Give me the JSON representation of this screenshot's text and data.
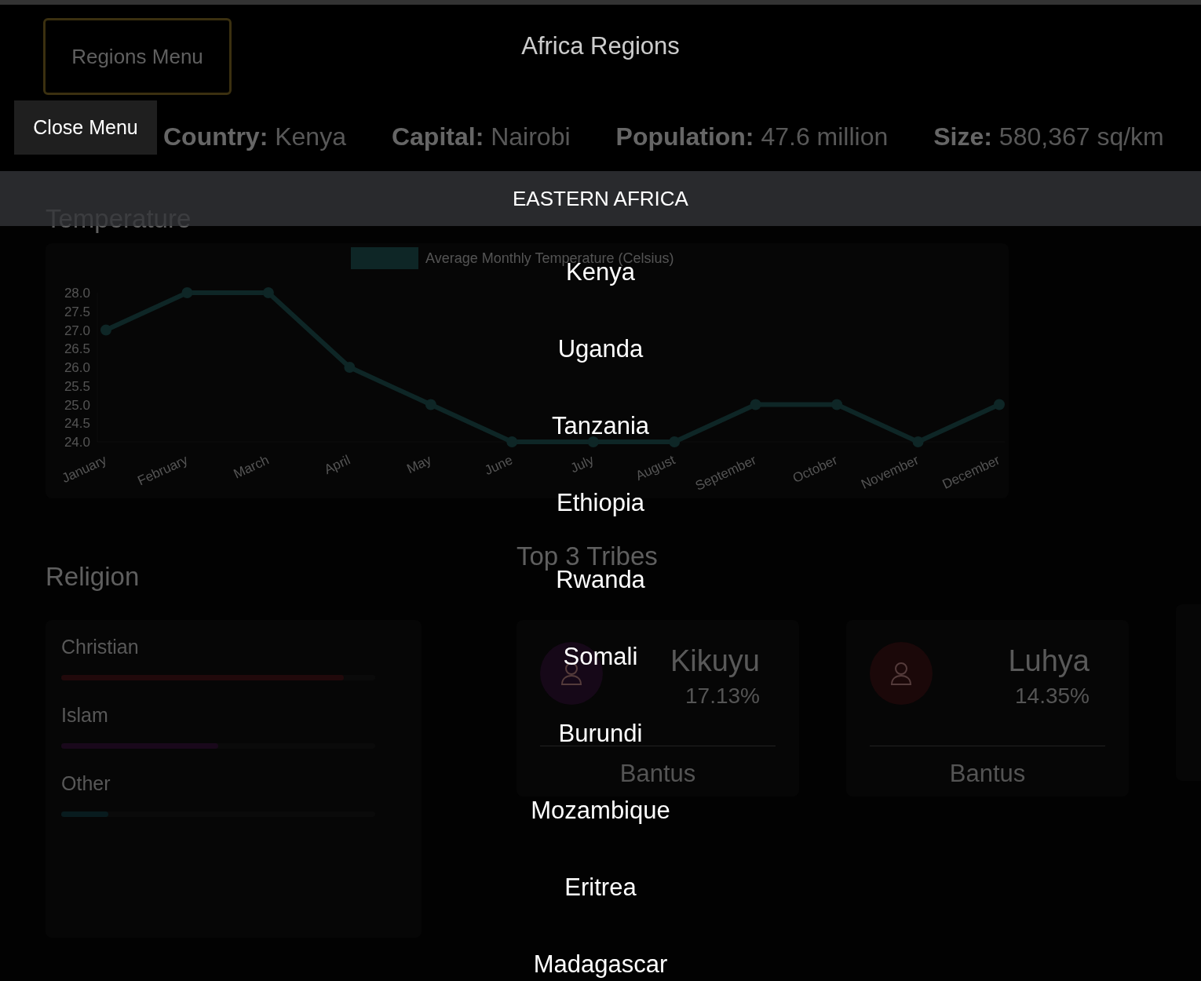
{
  "header": {
    "title": "Africa Regions",
    "menu_button": "Regions Menu"
  },
  "info": [
    {
      "label": "Country:",
      "value": "Kenya"
    },
    {
      "label": "Capital:",
      "value": "Nairobi"
    },
    {
      "label": "Population:",
      "value": "47.6 million"
    },
    {
      "label": "Size:",
      "value": "580,367 sq/km"
    }
  ],
  "temperature": {
    "heading": "Temperature",
    "chart_data": {
      "type": "line",
      "ylim": [
        22.48,
        29.33
      ],
      "categories": [
        "January",
        "February",
        "March",
        "April",
        "May",
        "June",
        "July",
        "August",
        "September",
        "October",
        "November",
        "December"
      ],
      "yticks": [
        {
          "value": 24,
          "label": "24.0"
        },
        {
          "value": 24.5,
          "label": "24.5"
        },
        {
          "value": 25,
          "label": "25.0"
        },
        {
          "value": 25.5,
          "label": "25.5"
        },
        {
          "value": 26,
          "label": "26.0"
        },
        {
          "value": 26.5,
          "label": "26.5"
        },
        {
          "value": 27,
          "label": "27.0"
        },
        {
          "value": 27.5,
          "label": "27.5"
        },
        {
          "value": 28,
          "label": "28.0"
        }
      ],
      "series": [
        {
          "name": "Average Monthly Temperature (Celsius)",
          "color": "#123030",
          "marker": true,
          "values": [
            27,
            28,
            28,
            26,
            25,
            24,
            24,
            24,
            25,
            25,
            24,
            25
          ]
        }
      ]
    }
  },
  "religion": {
    "heading": "Religion",
    "items": [
      {
        "label": "Christian",
        "level": 0.9,
        "color": "#2a0c0e"
      },
      {
        "label": "Islam",
        "level": 0.5,
        "color": "#200a22"
      },
      {
        "label": "Other",
        "level": 0.15,
        "color": "#0a2226"
      }
    ]
  },
  "tribes": {
    "heading": "Top 3 Tribes",
    "cards": [
      {
        "name": "Kikuyu",
        "share": "17.13%",
        "group": "Bantus",
        "color": "#1c0a1e"
      },
      {
        "name": "Luhya",
        "share": "14.35%",
        "group": "Bantus",
        "color": "#220a0c"
      }
    ]
  },
  "menu": {
    "close_button": "Close Menu",
    "region": "EASTERN AFRICA",
    "countries": [
      "Kenya",
      "Uganda",
      "Tanzania",
      "Ethiopia",
      "Rwanda",
      "Somali",
      "Burundi",
      "Mozambique",
      "Eritrea",
      "Madagascar"
    ]
  }
}
